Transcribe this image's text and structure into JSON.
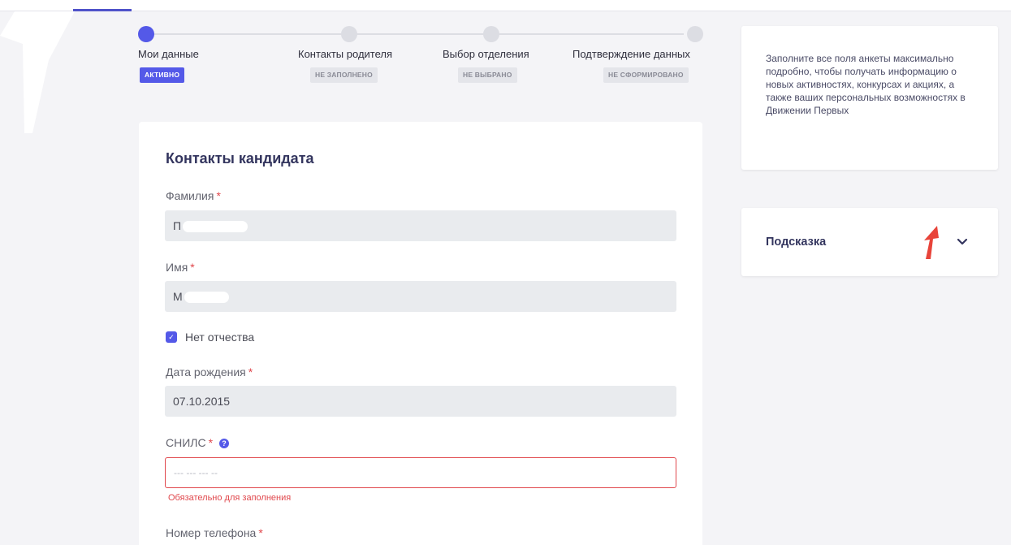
{
  "stepper": {
    "steps": [
      {
        "label": "Мои данные",
        "status": "АКТИВНО",
        "active": true
      },
      {
        "label": "Контакты родителя",
        "status": "НЕ ЗАПОЛНЕНО",
        "active": false
      },
      {
        "label": "Выбор отделения",
        "status": "НЕ ВЫБРАНО",
        "active": false
      },
      {
        "label": "Подтверждение данных",
        "status": "НЕ СФОРМИРОВАНО",
        "active": false
      }
    ]
  },
  "form": {
    "title": "Контакты кандидата",
    "required_mark": "*",
    "surname": {
      "label": "Фамилия",
      "value": "П"
    },
    "name": {
      "label": "Имя",
      "value": "М"
    },
    "no_patronymic": {
      "label": "Нет отчества",
      "checked": true
    },
    "birth_date": {
      "label": "Дата рождения",
      "value": "07.10.2015"
    },
    "snils": {
      "label": "СНИЛС",
      "placeholder": "--- --- --- --",
      "error": "Обязательно для заполнения"
    },
    "phone": {
      "label": "Номер телефона"
    }
  },
  "info": {
    "text": "Заполните все поля анкеты максимально подробно, чтобы получать информацию о новых активностях, конкурсах и акциях, а также ваших персональных возможностях в Движении Первых"
  },
  "hint": {
    "title": "Подсказка",
    "icon": "chevron-down-icon"
  },
  "colors": {
    "accent": "#5459e8",
    "error": "#e0474c",
    "title": "#33355e"
  }
}
